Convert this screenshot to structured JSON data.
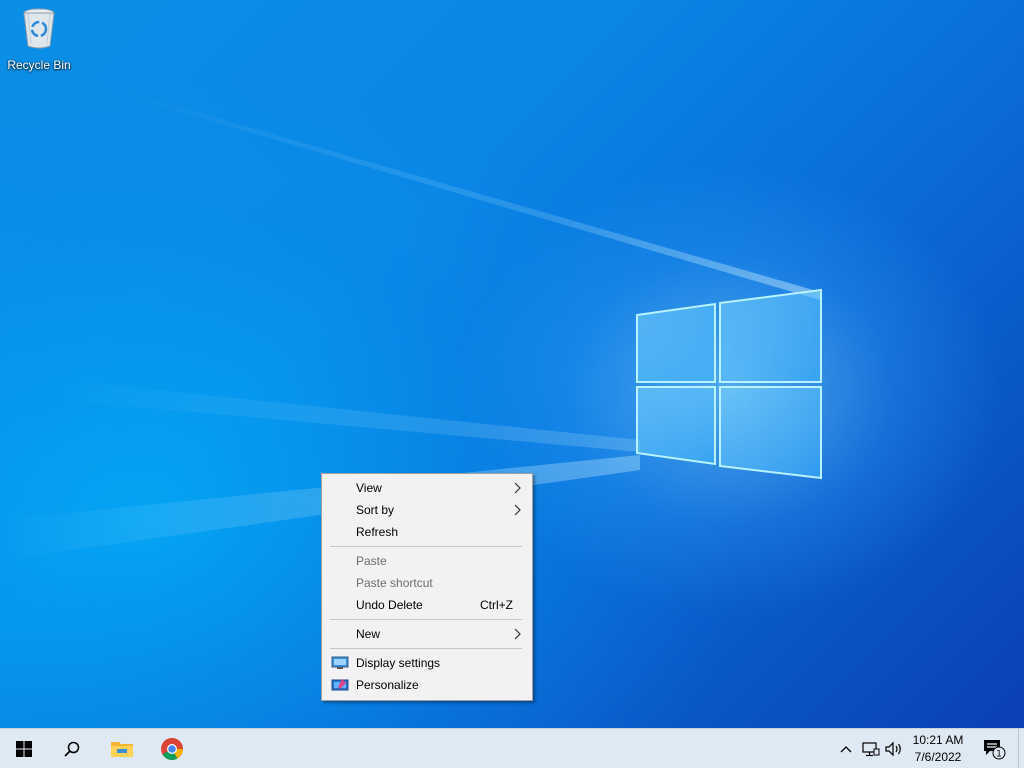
{
  "desktop": {
    "icons": [
      {
        "label": "Recycle Bin",
        "icon": "recycle-bin-icon"
      }
    ]
  },
  "context_menu": {
    "groups": [
      [
        {
          "label": "View",
          "submenu": true,
          "disabled": false
        },
        {
          "label": "Sort by",
          "submenu": true,
          "disabled": false
        },
        {
          "label": "Refresh",
          "submenu": false,
          "disabled": false
        }
      ],
      [
        {
          "label": "Paste",
          "submenu": false,
          "disabled": true
        },
        {
          "label": "Paste shortcut",
          "submenu": false,
          "disabled": true
        },
        {
          "label": "Undo Delete",
          "shortcut": "Ctrl+Z",
          "submenu": false,
          "disabled": false
        }
      ],
      [
        {
          "label": "New",
          "submenu": true,
          "disabled": false
        }
      ],
      [
        {
          "label": "Display settings",
          "icon": "display-settings-icon",
          "disabled": false
        },
        {
          "label": "Personalize",
          "icon": "personalize-icon",
          "disabled": false
        }
      ]
    ]
  },
  "taskbar": {
    "pinned": [
      {
        "name": "start-button",
        "icon": "windows-logo-icon"
      },
      {
        "name": "search-button",
        "icon": "search-icon"
      },
      {
        "name": "file-explorer-button",
        "icon": "folder-icon"
      },
      {
        "name": "chrome-button",
        "icon": "chrome-icon"
      }
    ],
    "tray": {
      "icons": [
        "chevron-up-icon",
        "network-icon",
        "volume-icon"
      ],
      "time": "10:21 AM",
      "date": "7/6/2022",
      "notification_count": "1"
    }
  },
  "colors": {
    "desktop_accent": "#0a78e0",
    "taskbar_bg": "#dfe9f3",
    "menu_bg": "#f2f2f2",
    "disabled_text": "#6d6d6d"
  }
}
